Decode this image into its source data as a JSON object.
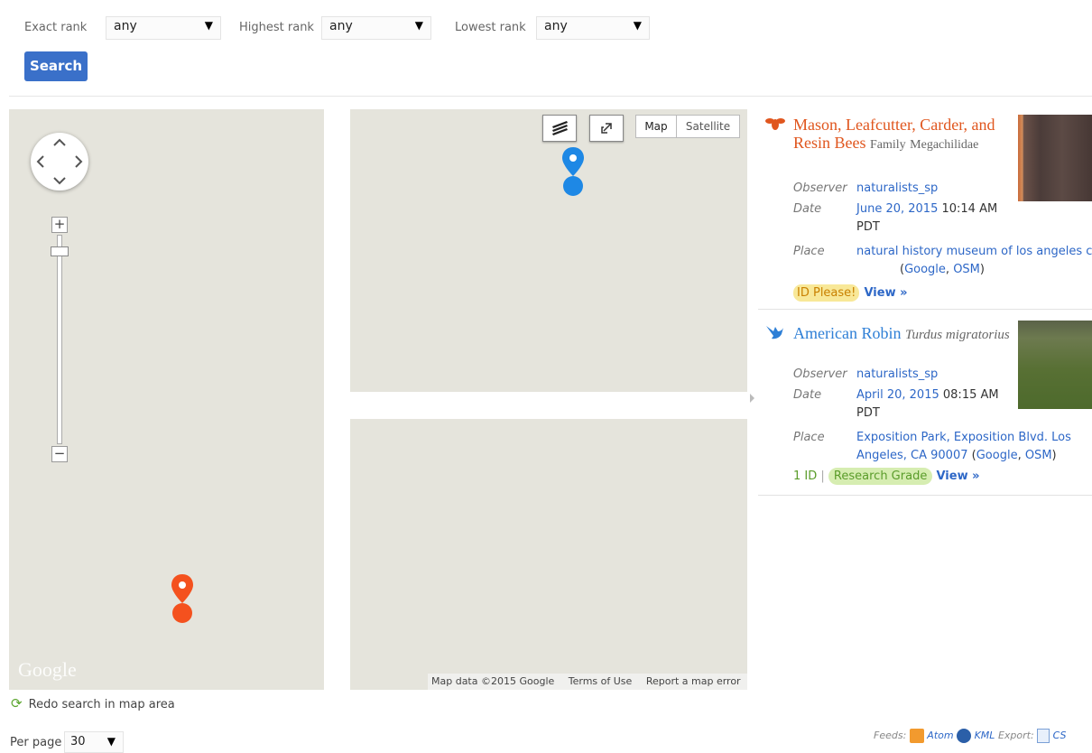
{
  "filters": {
    "exact_rank_label": "Exact rank",
    "exact_rank_value": "any",
    "highest_rank_label": "Highest rank",
    "highest_rank_value": "any",
    "lowest_rank_label": "Lowest rank",
    "lowest_rank_value": "any",
    "search_label": "Search"
  },
  "map": {
    "type_map": "Map",
    "type_satellite": "Satellite",
    "attribution": "Map data ©2015 Google",
    "terms": "Terms of Use",
    "report": "Report a map error",
    "google_logo": "Google",
    "zoom_in": "+",
    "zoom_out": "−",
    "redo_search": "Redo search in map area",
    "marker_colors": {
      "blue": "#1e88e5",
      "orange": "#f4511e"
    }
  },
  "results": [
    {
      "icon": "bee-icon",
      "common_name": "Mason, Leafcutter, Carder, and Resin Bees",
      "rank": "Family",
      "sci_name": "Megachilidae",
      "observer_label": "Observer",
      "observer": "naturalists_sp",
      "date_label": "Date",
      "date": "June 20, 2015",
      "time": "10:14 AM",
      "tz": "PDT",
      "place_label": "Place",
      "place": "natural history museum of los angeles county",
      "google": "Google",
      "osm": "OSM",
      "quality": "ID Please!",
      "view": "View »",
      "title_color": "#e0561e"
    },
    {
      "icon": "bird-icon",
      "common_name": "American Robin",
      "sci_name": "Turdus migratorius",
      "observer_label": "Observer",
      "observer": "naturalists_sp",
      "date_label": "Date",
      "date": "April 20, 2015",
      "time": "08:15 AM",
      "tz": "PDT",
      "place_label": "Place",
      "place": "Exposition Park, Exposition Blvd. Los Angeles, CA 90007",
      "google": "Google",
      "osm": "OSM",
      "id_count": "1 ID",
      "quality": "Research Grade",
      "view": "View »",
      "title_color": "#2e7fd6"
    }
  ],
  "footer": {
    "per_page_label": "Per page",
    "per_page_value": "30",
    "feeds_label": "Feeds:",
    "atom": "Atom",
    "kml": "KML",
    "export_label": "Export:",
    "csv": "CS"
  }
}
